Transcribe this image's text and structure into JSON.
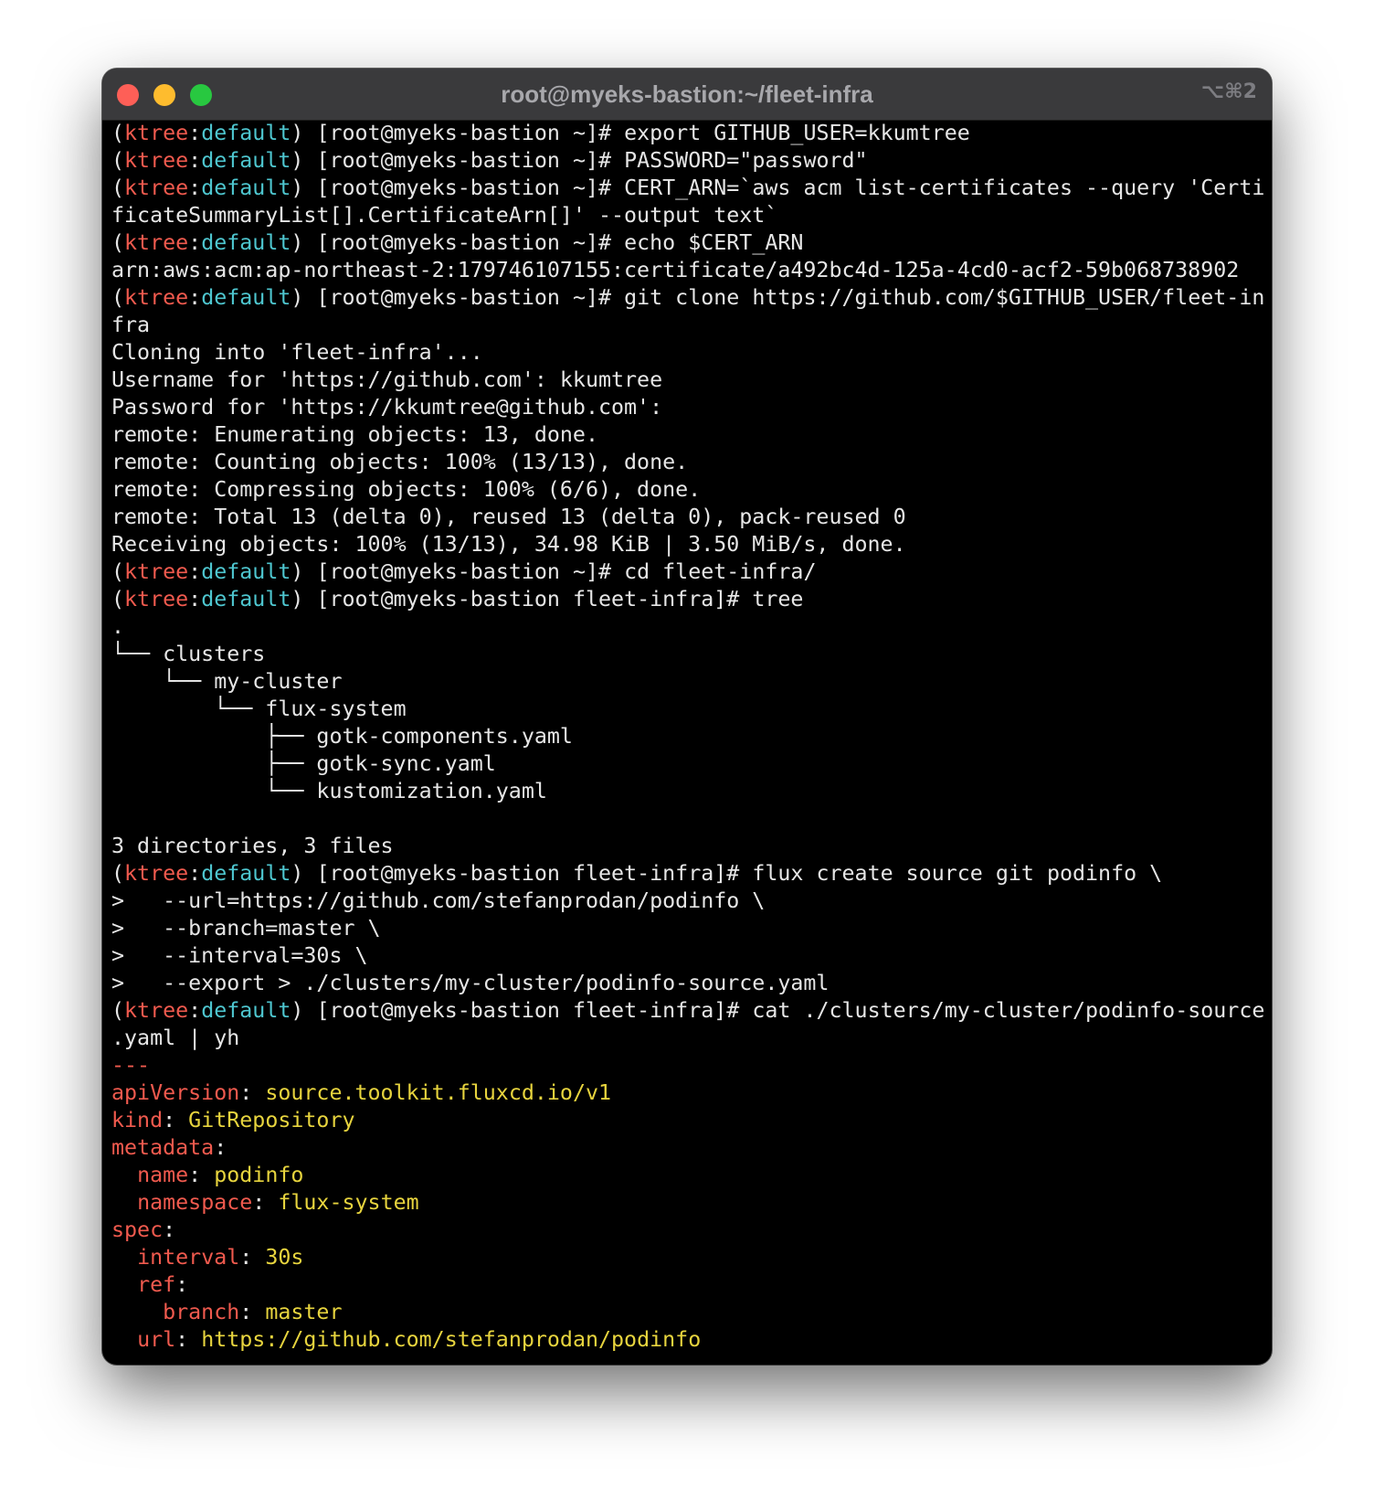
{
  "window": {
    "title": "root@myeks-bastion:~/fleet-infra",
    "shortcut": "⌥⌘2"
  },
  "colors": {
    "context": "#f05a4e",
    "namespace": "#4ec6cf",
    "text": "#e6e6e6",
    "yaml_key": "#f05a4e",
    "yaml_value": "#e7d43e",
    "background": "#000000",
    "titlebar": "#3a3a3c"
  },
  "terminal": {
    "prompt": {
      "context": "ktree",
      "namespace": "default",
      "home": "[root@myeks-bastion ~]# ",
      "repo": "[root@myeks-bastion fleet-infra]# "
    },
    "lines": [
      {
        "type": "prompt",
        "dir": "home",
        "cmd": "export GITHUB_USER=kkumtree"
      },
      {
        "type": "prompt",
        "dir": "home",
        "cmd": "PASSWORD=\"password\""
      },
      {
        "type": "prompt",
        "dir": "home",
        "cmd": "CERT_ARN=`aws acm list-certificates --query 'Certi"
      },
      {
        "type": "out",
        "text": "ficateSummaryList[].CertificateArn[]' --output text`"
      },
      {
        "type": "prompt",
        "dir": "home",
        "cmd": "echo $CERT_ARN"
      },
      {
        "type": "out",
        "text": "arn:aws:acm:ap-northeast-2:179746107155:certificate/a492bc4d-125a-4cd0-acf2-59b068738902"
      },
      {
        "type": "prompt",
        "dir": "home",
        "cmd": "git clone https://github.com/$GITHUB_USER/fleet-in"
      },
      {
        "type": "out",
        "text": "fra"
      },
      {
        "type": "out",
        "text": "Cloning into 'fleet-infra'..."
      },
      {
        "type": "out",
        "text": "Username for 'https://github.com': kkumtree"
      },
      {
        "type": "out",
        "text": "Password for 'https://kkumtree@github.com':"
      },
      {
        "type": "out",
        "text": "remote: Enumerating objects: 13, done."
      },
      {
        "type": "out",
        "text": "remote: Counting objects: 100% (13/13), done."
      },
      {
        "type": "out",
        "text": "remote: Compressing objects: 100% (6/6), done."
      },
      {
        "type": "out",
        "text": "remote: Total 13 (delta 0), reused 13 (delta 0), pack-reused 0"
      },
      {
        "type": "out",
        "text": "Receiving objects: 100% (13/13), 34.98 KiB | 3.50 MiB/s, done."
      },
      {
        "type": "prompt",
        "dir": "home",
        "cmd": "cd fleet-infra/"
      },
      {
        "type": "prompt",
        "dir": "repo",
        "cmd": "tree"
      },
      {
        "type": "out",
        "text": "."
      },
      {
        "type": "out",
        "text": "└── clusters"
      },
      {
        "type": "out",
        "text": "    └── my-cluster"
      },
      {
        "type": "out",
        "text": "        └── flux-system"
      },
      {
        "type": "out",
        "text": "            ├── gotk-components.yaml"
      },
      {
        "type": "out",
        "text": "            ├── gotk-sync.yaml"
      },
      {
        "type": "out",
        "text": "            └── kustomization.yaml"
      },
      {
        "type": "out",
        "text": ""
      },
      {
        "type": "out",
        "text": "3 directories, 3 files"
      },
      {
        "type": "prompt",
        "dir": "repo",
        "cmd": "flux create source git podinfo \\"
      },
      {
        "type": "out",
        "text": ">   --url=https://github.com/stefanprodan/podinfo \\"
      },
      {
        "type": "out",
        "text": ">   --branch=master \\"
      },
      {
        "type": "out",
        "text": ">   --interval=30s \\"
      },
      {
        "type": "out",
        "text": ">   --export > ./clusters/my-cluster/podinfo-source.yaml"
      },
      {
        "type": "prompt",
        "dir": "repo",
        "cmd": "cat ./clusters/my-cluster/podinfo-source"
      },
      {
        "type": "out",
        "text": ".yaml | yh"
      },
      {
        "type": "sep",
        "text": "---"
      },
      {
        "type": "yaml",
        "indent": "",
        "key": "apiVersion",
        "value": "source.toolkit.fluxcd.io/v1"
      },
      {
        "type": "yaml",
        "indent": "",
        "key": "kind",
        "value": "GitRepository"
      },
      {
        "type": "yaml",
        "indent": "",
        "key": "metadata",
        "value": ""
      },
      {
        "type": "yaml",
        "indent": "  ",
        "key": "name",
        "value": "podinfo"
      },
      {
        "type": "yaml",
        "indent": "  ",
        "key": "namespace",
        "value": "flux-system"
      },
      {
        "type": "yaml",
        "indent": "",
        "key": "spec",
        "value": ""
      },
      {
        "type": "yaml",
        "indent": "  ",
        "key": "interval",
        "value": "30s"
      },
      {
        "type": "yaml",
        "indent": "  ",
        "key": "ref",
        "value": ""
      },
      {
        "type": "yaml",
        "indent": "    ",
        "key": "branch",
        "value": "master"
      },
      {
        "type": "yaml",
        "indent": "  ",
        "key": "url",
        "value": "https://github.com/stefanprodan/podinfo"
      }
    ]
  }
}
